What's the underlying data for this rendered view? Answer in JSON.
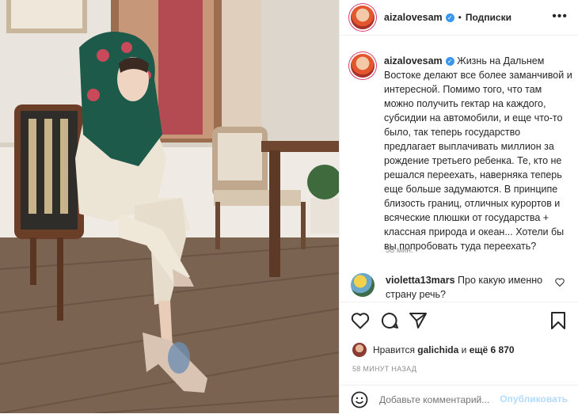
{
  "post": {
    "username": "aizalovesam",
    "verified_badge": "✓",
    "separator": "•",
    "follow_label": "Подписки",
    "more_label": "•••",
    "caption": "Жизнь на Дальнем Востоке делают все более заманчивой и интересной. Помимо того, что там можно получить гектар на каждого, субсидии на автомобили, и еще что-то было, так теперь государство предлагает выплачивать миллион за рождение третьего ребенка. Те, кто не решался переехать, наверняка теперь еще больше задумаются. В принципе близость границ, отличных курортов и всяческие плюшки от государства + классная природа и океан... Хотели бы вы попробовать туда переехать?",
    "caption_time": "58 мин.",
    "timestamp": "58 МИНУТ НАЗАД"
  },
  "comment": {
    "username": "violetta13mars",
    "text": "Про какую именно страну речь?"
  },
  "likes": {
    "prefix": "Нравится",
    "user": "galichida",
    "and": "и",
    "rest": "ещё 6 870"
  },
  "add_comment": {
    "placeholder": "Добавьте комментарий...",
    "publish_label": "Опубликовать"
  },
  "icons": {
    "verified": "verified-badge-icon",
    "more": "more-options-icon",
    "like": "heart-icon",
    "comment": "comment-icon",
    "share": "share-icon",
    "save": "bookmark-icon",
    "emoji": "emoji-icon"
  },
  "colors": {
    "accent_blue": "#3897f0",
    "publish_disabled": "#b3dbff",
    "muted": "#8e8e8e"
  }
}
